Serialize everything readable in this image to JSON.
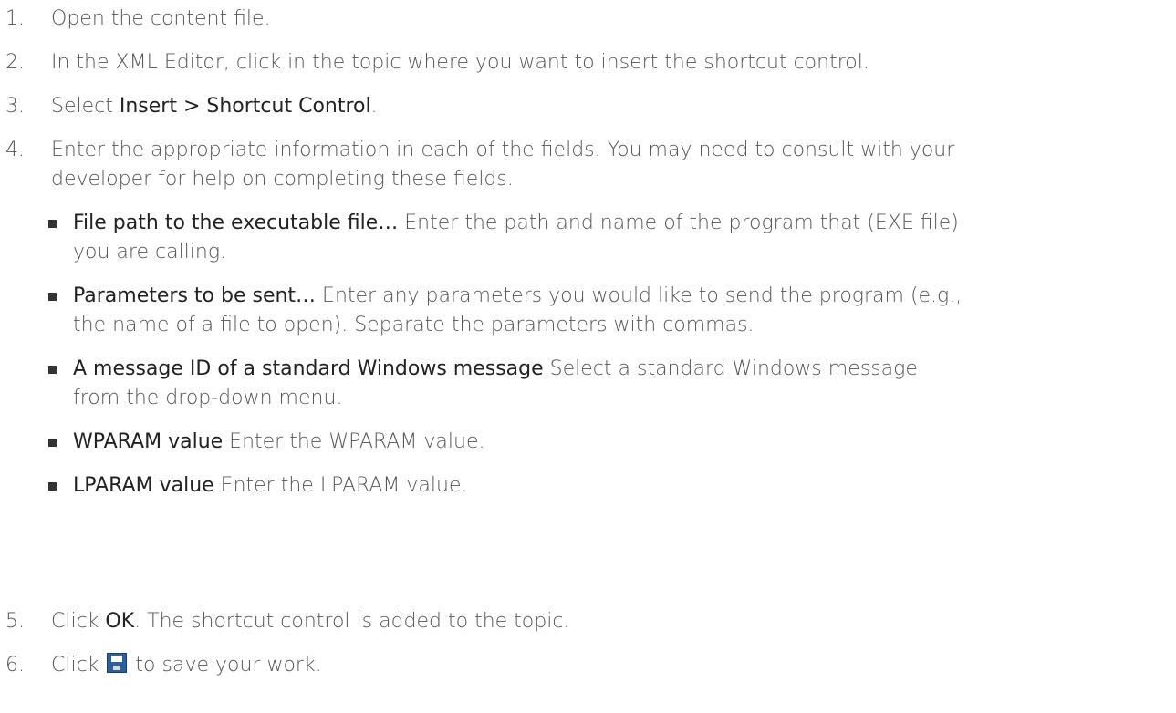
{
  "steps": [
    {
      "num": "1.",
      "text": "Open the content file."
    },
    {
      "num": "2.",
      "text": "In the XML Editor, click in the topic where you want to insert the shortcut control."
    },
    {
      "num": "3.",
      "pre": "Select ",
      "bold": "Insert > Shortcut Control",
      "post": "."
    },
    {
      "num": "4.",
      "line1": "Enter the appropriate information in each of the fields. You may need to consult with your",
      "line2": "developer for help on completing these fields."
    },
    {
      "num": "5.",
      "pre": "Click ",
      "bold": "OK",
      "post": ". The shortcut control is added to the topic."
    },
    {
      "num": "6.",
      "pre": "Click ",
      "post": " to save your work.",
      "icon": "save-icon"
    }
  ],
  "fields": [
    {
      "bold": "File path to the executable file…",
      "line1": " Enter the path and name of the program that (EXE file)",
      "line2": "you are calling."
    },
    {
      "bold": "Parameters to be sent…",
      "line1": " Enter any parameters you would like to send the program (e.g.,",
      "line2": "the name of a file to open). Separate the parameters with commas."
    },
    {
      "bold": "A message ID of a standard Windows message",
      "line1": " Select a standard Windows message",
      "line2": "from the drop-down menu."
    },
    {
      "bold": "WPARAM value",
      "line1": " Enter the WPARAM value."
    },
    {
      "bold": "LPARAM value",
      "line1": " Enter the LPARAM value."
    }
  ]
}
